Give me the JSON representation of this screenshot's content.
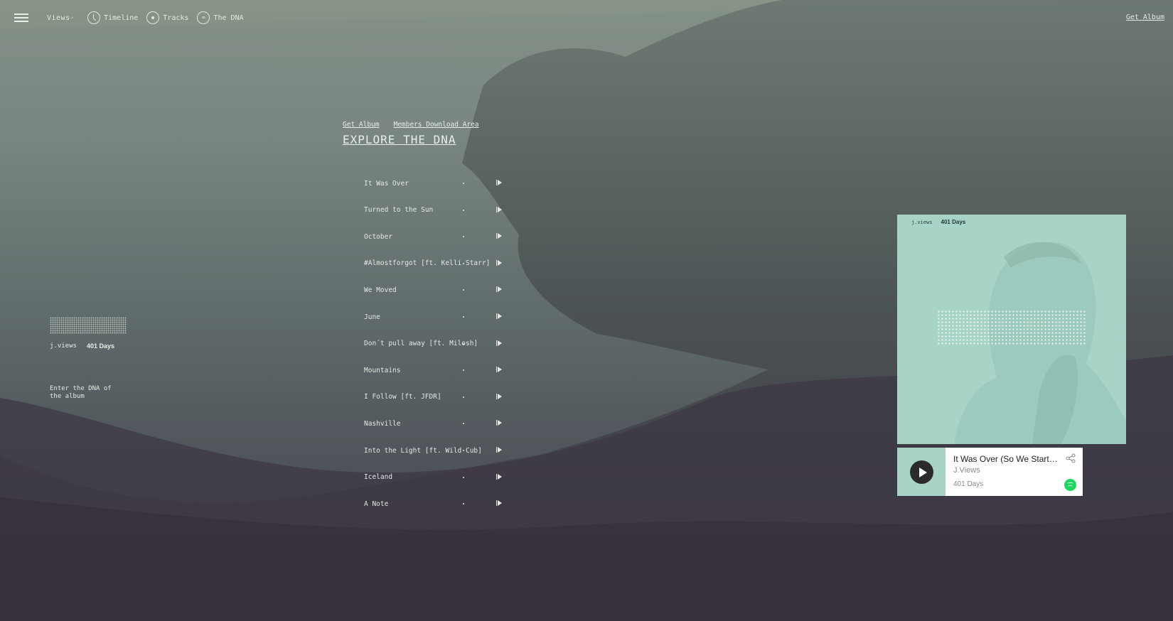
{
  "nav": {
    "brand": "Views-",
    "items": [
      {
        "label": "Timeline",
        "icon": "clock-icon"
      },
      {
        "label": "Tracks",
        "icon": "disc-icon"
      },
      {
        "label": "The DNA",
        "icon": "dna-icon"
      }
    ],
    "get_album": "Get Album"
  },
  "center": {
    "get_album": "Get Album",
    "members": "Members Download Area",
    "heading": "EXPLORE THE DNA",
    "tracks": [
      "It Was Over",
      "Turned to the Sun",
      "October",
      "#Almostforgot [ft. Kelli Starr]",
      "We Moved",
      "June",
      "Don´t pull away [ft. Milosh]",
      "Mountains",
      "I Follow [ft. JFDR]",
      "Nashville",
      "Into the Light [ft. Wild Cub]",
      "Iceland",
      "A Note"
    ]
  },
  "left": {
    "artist": "j.views",
    "album": "401 Days",
    "enter": "Enter the DNA of the album"
  },
  "album_card": {
    "artist": "j.views",
    "album": "401 Days"
  },
  "spotify": {
    "title": "It Was Over (So We Started Again)",
    "artist": "J.Views",
    "album": "401 Days"
  },
  "colors": {
    "album_bg": "#a8d4c8",
    "spotify_green": "#1ed760"
  }
}
